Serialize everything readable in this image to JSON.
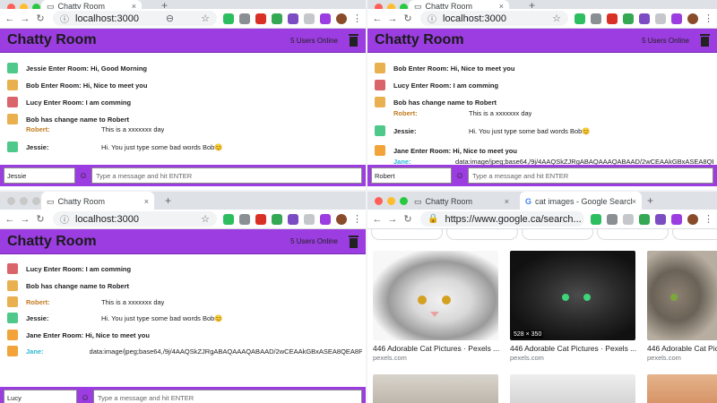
{
  "browser": {
    "tab_title": "Chatty Room",
    "url": "localhost:3000",
    "new_tab": "+",
    "tab_close": "×",
    "kebab": "⋮",
    "back": "←",
    "forward": "→",
    "reload": "↻",
    "info": "ⓘ",
    "zoom": "⊖",
    "star": "☆"
  },
  "chat": {
    "title": "Chatty Room",
    "online": "5 Users Online",
    "placeholder": "Type a message and hit ENTER",
    "smiley": "☺",
    "users": [
      "Jessie",
      "Robert",
      "Lucy"
    ]
  },
  "messages": {
    "w1": [
      {
        "type": "system",
        "text": "Jessie Enter Room: Hi, Good Morning"
      },
      {
        "type": "system",
        "text": "Bob Enter Room: Hi, Nice to meet you"
      },
      {
        "type": "system",
        "text": "Lucy Enter Room: I am comming"
      },
      {
        "type": "system",
        "text": "Bob has change name to Robert"
      },
      {
        "type": "chat",
        "name": "Robert:",
        "text": "This is a xxxxxxx day"
      },
      {
        "type": "chat",
        "name": "Jessie:",
        "text": "Hi. You just type some bad words Bob😊"
      }
    ],
    "w2": [
      {
        "type": "system",
        "text": "Bob Enter Room: Hi, Nice to meet you"
      },
      {
        "type": "system",
        "text": "Lucy Enter Room: I am comming"
      },
      {
        "type": "system",
        "text": "Bob has change name to Robert"
      },
      {
        "type": "chat",
        "name": "Robert:",
        "text": "This is a xxxxxxx day"
      },
      {
        "type": "chat",
        "name": "Jessie:",
        "text": "Hi. You just type some bad words Bob😊"
      },
      {
        "type": "system",
        "text": "Jane Enter Room: Hi, Nice to meet you"
      },
      {
        "type": "chat",
        "name": "Jane:",
        "text": "data:image/jpeg;base64,/9j/4AAQSkZJRgABAQAAAQABAAD/2wCEAAkGBxASEA8QEA8PEBAVEBUVE"
      }
    ],
    "w3": [
      {
        "type": "system",
        "text": "Lucy Enter Room: I am comming"
      },
      {
        "type": "system",
        "text": "Bob has change name to Robert"
      },
      {
        "type": "chat",
        "name": "Robert:",
        "text": "This is a xxxxxxx day"
      },
      {
        "type": "chat",
        "name": "Jessie:",
        "text": "Hi. You just type some bad words Bob😊"
      },
      {
        "type": "system",
        "text": "Jane Enter Room: Hi, Nice to meet you"
      },
      {
        "type": "chat",
        "name": "Jane:",
        "text": "data:image/jpeg;base64,/9j/4AAQSkZJRgABAQAAAQABAAD/2wCEAAkGBxASEA8QEA8PEBAVEBUVEBEI"
      }
    ]
  },
  "google": {
    "tab_title": "cat images - Google Search",
    "url": "https://www.google.ca/search...",
    "results": [
      {
        "title": "446 Adorable Cat Pictures · Pexels ...",
        "source": "pexels.com"
      },
      {
        "title": "446 Adorable Cat Pictures · Pexels ...",
        "source": "pexels.com"
      },
      {
        "title": "446 Adorable Cat Pictures · Pexels ...",
        "source": "pexels.com"
      }
    ],
    "image_size": "528 × 350"
  },
  "colors": {
    "header": "#9b3de0",
    "robert": "#c07a1e",
    "jessie": "#1f2a33",
    "jane": "#2ab7d6"
  }
}
